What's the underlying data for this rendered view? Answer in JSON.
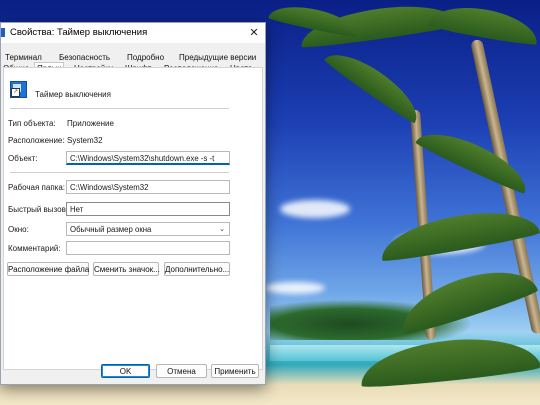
{
  "dialog": {
    "title": "Свойства: Таймер выключения",
    "close_glyph": "✕"
  },
  "tabs_back": [
    "Терминал",
    "Безопасность",
    "Подробно",
    "Предыдущие версии"
  ],
  "tabs_front": [
    "Общие",
    "Ярлык",
    "Настройки",
    "Шрифт",
    "Расположение",
    "Цвета"
  ],
  "active_tab": "Ярлык",
  "shortcut": {
    "name": "Таймер выключения",
    "target_type_label": "Тип объекта:",
    "target_type_value": "Приложение",
    "location_label": "Расположение:",
    "location_value": "System32",
    "target_label": "Объект:",
    "target_value": "C:\\Windows\\System32\\shutdown.exe -s -t",
    "start_in_label": "Рабочая папка:",
    "start_in_value": "C:\\Windows\\System32",
    "hotkey_label": "Быстрый вызов:",
    "hotkey_value": "Нет",
    "run_label": "Окно:",
    "run_value": "Обычный размер окна",
    "comment_label": "Комментарий:",
    "comment_value": ""
  },
  "actions": {
    "open_location": "Расположение файла",
    "change_icon": "Сменить значок...",
    "advanced": "Дополнительно..."
  },
  "footer": {
    "ok": "OK",
    "cancel": "Отмена",
    "apply": "Применить"
  },
  "colors": {
    "accent": "#0063b1"
  },
  "icons": [
    "shortcut-app-icon",
    "close-icon",
    "chevron-down-icon"
  ]
}
